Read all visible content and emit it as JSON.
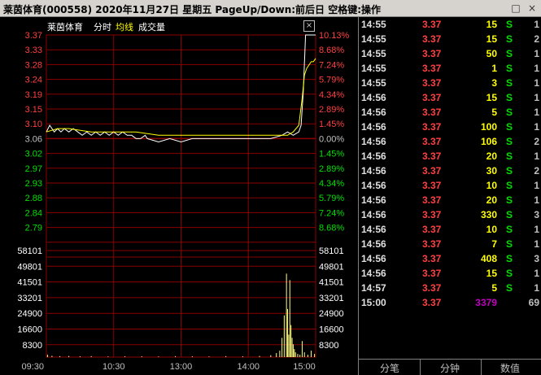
{
  "window": {
    "title": "莱茵体育(000558)  2020年11月27日  星期五  PageUp/Down:前后日  空格键:操作",
    "buttons": [
      "□",
      "×"
    ]
  },
  "chart_header": {
    "name": "莱茵体育",
    "mode": "分时",
    "series": [
      "均线",
      "成交量"
    ],
    "close": "×"
  },
  "chart_data": [
    {
      "type": "line",
      "title": "",
      "x_ticks": [
        "09:30",
        "10:30",
        "13:00",
        "14:00",
        "15:00"
      ],
      "prev_close": 3.06,
      "ylim": [
        2.75,
        3.37
      ],
      "y_ticks_left": [
        "3.37",
        "3.33",
        "3.28",
        "3.24",
        "3.19",
        "3.15",
        "3.10",
        "3.06",
        "3.02",
        "2.97",
        "2.93",
        "2.88",
        "2.84",
        "2.79"
      ],
      "y_ticks_right": [
        "10.13%",
        "8.68%",
        "7.24%",
        "5.79%",
        "4.34%",
        "2.89%",
        "1.45%",
        "0.00%",
        "1.45%",
        "2.89%",
        "4.34%",
        "5.79%",
        "7.24%",
        "8.68%"
      ],
      "series": [
        {
          "name": "分时",
          "color": "#ffffff",
          "x": [
            0,
            3,
            5,
            7,
            10,
            13,
            16,
            20,
            24,
            28,
            32,
            36,
            40,
            44,
            48,
            52,
            56,
            60,
            64,
            68,
            72,
            76,
            80,
            84,
            88,
            90,
            100,
            110,
            120,
            130,
            140,
            150,
            160,
            170,
            172,
            174,
            176,
            178,
            180,
            185,
            190,
            200,
            210,
            215,
            220,
            225,
            227,
            229,
            231,
            233,
            235,
            237,
            240
          ],
          "y": [
            3.08,
            3.1,
            3.09,
            3.08,
            3.09,
            3.08,
            3.09,
            3.08,
            3.09,
            3.08,
            3.07,
            3.08,
            3.07,
            3.08,
            3.07,
            3.08,
            3.07,
            3.08,
            3.07,
            3.08,
            3.07,
            3.07,
            3.06,
            3.06,
            3.07,
            3.06,
            3.05,
            3.06,
            3.05,
            3.06,
            3.06,
            3.06,
            3.06,
            3.06,
            3.06,
            3.06,
            3.06,
            3.06,
            3.06,
            3.06,
            3.06,
            3.06,
            3.07,
            3.08,
            3.07,
            3.08,
            3.1,
            3.2,
            3.37,
            3.37,
            3.37,
            3.37,
            3.37
          ]
        },
        {
          "name": "均线",
          "color": "#ffff00",
          "x": [
            0,
            10,
            20,
            40,
            60,
            80,
            100,
            120,
            140,
            160,
            180,
            200,
            210,
            215,
            220,
            225,
            228,
            230,
            232,
            234,
            236,
            238,
            240
          ],
          "y": [
            3.08,
            3.09,
            3.09,
            3.08,
            3.08,
            3.08,
            3.07,
            3.07,
            3.07,
            3.07,
            3.07,
            3.07,
            3.07,
            3.07,
            3.08,
            3.1,
            3.18,
            3.25,
            3.27,
            3.28,
            3.29,
            3.29,
            3.3
          ]
        }
      ]
    },
    {
      "type": "bar",
      "title": "",
      "y_ticks": [
        "58101",
        "49801",
        "41501",
        "33201",
        "24900",
        "16600",
        "8300"
      ],
      "ylim": [
        0,
        66400
      ],
      "series": [
        {
          "name": "成交量",
          "color": "#ffff80",
          "x": [
            1,
            5,
            12,
            20,
            30,
            40,
            55,
            70,
            85,
            100,
            115,
            130,
            145,
            160,
            175,
            190,
            200,
            205,
            208,
            210,
            212,
            214,
            215,
            216,
            217,
            218,
            219,
            220,
            221,
            222,
            224,
            226,
            228,
            230,
            233,
            236,
            239
          ],
          "values": [
            1500,
            800,
            600,
            700,
            500,
            600,
            400,
            500,
            500,
            400,
            600,
            500,
            400,
            600,
            500,
            700,
            1200,
            2500,
            4000,
            12000,
            26000,
            52000,
            30000,
            14000,
            48000,
            20000,
            12000,
            8000,
            5000,
            3000,
            2000,
            1500,
            10000,
            3000,
            1500,
            4000,
            2000
          ]
        }
      ]
    }
  ],
  "trades": [
    {
      "time": "14:55",
      "price": "3.37",
      "vol": "15",
      "vol_color": "#ffff00",
      "side": "S",
      "cnt": "1"
    },
    {
      "time": "14:55",
      "price": "3.37",
      "vol": "15",
      "vol_color": "#ffff00",
      "side": "S",
      "cnt": "2"
    },
    {
      "time": "14:55",
      "price": "3.37",
      "vol": "50",
      "vol_color": "#ffff00",
      "side": "S",
      "cnt": "1"
    },
    {
      "time": "14:55",
      "price": "3.37",
      "vol": "1",
      "vol_color": "#ffff00",
      "side": "S",
      "cnt": "1"
    },
    {
      "time": "14:55",
      "price": "3.37",
      "vol": "3",
      "vol_color": "#ffff00",
      "side": "S",
      "cnt": "1"
    },
    {
      "time": "14:56",
      "price": "3.37",
      "vol": "15",
      "vol_color": "#ffff00",
      "side": "S",
      "cnt": "1"
    },
    {
      "time": "14:56",
      "price": "3.37",
      "vol": "5",
      "vol_color": "#ffff00",
      "side": "S",
      "cnt": "1"
    },
    {
      "time": "14:56",
      "price": "3.37",
      "vol": "100",
      "vol_color": "#ffff00",
      "side": "S",
      "cnt": "1"
    },
    {
      "time": "14:56",
      "price": "3.37",
      "vol": "106",
      "vol_color": "#ffff00",
      "side": "S",
      "cnt": "2"
    },
    {
      "time": "14:56",
      "price": "3.37",
      "vol": "20",
      "vol_color": "#ffff00",
      "side": "S",
      "cnt": "1"
    },
    {
      "time": "14:56",
      "price": "3.37",
      "vol": "30",
      "vol_color": "#ffff00",
      "side": "S",
      "cnt": "2"
    },
    {
      "time": "14:56",
      "price": "3.37",
      "vol": "10",
      "vol_color": "#ffff00",
      "side": "S",
      "cnt": "1"
    },
    {
      "time": "14:56",
      "price": "3.37",
      "vol": "20",
      "vol_color": "#ffff00",
      "side": "S",
      "cnt": "1"
    },
    {
      "time": "14:56",
      "price": "3.37",
      "vol": "330",
      "vol_color": "#ffff00",
      "side": "S",
      "cnt": "3"
    },
    {
      "time": "14:56",
      "price": "3.37",
      "vol": "10",
      "vol_color": "#ffff00",
      "side": "S",
      "cnt": "1"
    },
    {
      "time": "14:56",
      "price": "3.37",
      "vol": "7",
      "vol_color": "#ffff00",
      "side": "S",
      "cnt": "1"
    },
    {
      "time": "14:56",
      "price": "3.37",
      "vol": "408",
      "vol_color": "#ffff00",
      "side": "S",
      "cnt": "3"
    },
    {
      "time": "14:56",
      "price": "3.37",
      "vol": "15",
      "vol_color": "#ffff00",
      "side": "S",
      "cnt": "1"
    },
    {
      "time": "14:57",
      "price": "3.37",
      "vol": "5",
      "vol_color": "#ffff00",
      "side": "S",
      "cnt": "1"
    },
    {
      "time": "15:00",
      "price": "3.37",
      "vol": "3379",
      "vol_color": "#c000c0",
      "side": "",
      "cnt": "69"
    }
  ],
  "tabs": [
    "分笔",
    "分钟",
    "数值"
  ],
  "colors": {
    "grid": "#8b0000",
    "up": "#ff4040",
    "flat": "#c0c0c0",
    "down": "#00e000",
    "price_line": "#ffffff",
    "avg_line": "#ffff00",
    "volume": "#ffff80"
  }
}
